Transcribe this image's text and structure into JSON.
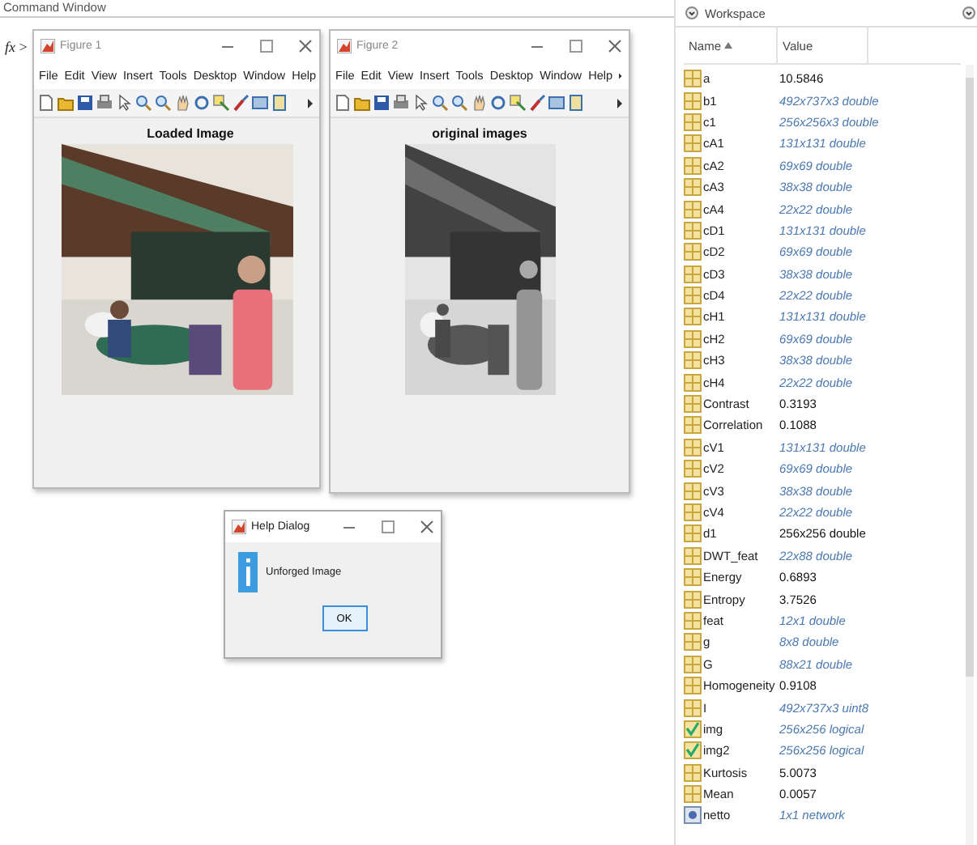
{
  "command_window": {
    "title": "Command Window",
    "prompt": "*fx* >"
  },
  "figures": [
    {
      "title": "Figure 1",
      "menu": [
        "File",
        "Edit",
        "View",
        "Insert",
        "Tools",
        "Desktop",
        "Window",
        "Help"
      ],
      "axes_title": "Loaded Image",
      "grayscale": false
    },
    {
      "title": "Figure 2",
      "menu": [
        "File",
        "Edit",
        "View",
        "Insert",
        "Tools",
        "Desktop",
        "Window",
        "Help"
      ],
      "axes_title": "original images",
      "grayscale": true
    }
  ],
  "dialog": {
    "title": "Help Dialog",
    "message": "Unforged Image",
    "button": "OK"
  },
  "workspace": {
    "title": "Workspace",
    "columns": [
      "Name",
      "Value"
    ],
    "variables": [
      {
        "name": "a",
        "value": "10.5846",
        "kind": "numeric",
        "summary": false
      },
      {
        "name": "b1",
        "value": "492x737x3 double",
        "kind": "numeric",
        "summary": true
      },
      {
        "name": "c1",
        "value": "256x256x3 double",
        "kind": "numeric",
        "summary": true
      },
      {
        "name": "cA1",
        "value": "131x131 double",
        "kind": "numeric",
        "summary": true
      },
      {
        "name": "cA2",
        "value": "69x69 double",
        "kind": "numeric",
        "summary": true
      },
      {
        "name": "cA3",
        "value": "38x38 double",
        "kind": "numeric",
        "summary": true
      },
      {
        "name": "cA4",
        "value": "22x22 double",
        "kind": "numeric",
        "summary": true
      },
      {
        "name": "cD1",
        "value": "131x131 double",
        "kind": "numeric",
        "summary": true
      },
      {
        "name": "cD2",
        "value": "69x69 double",
        "kind": "numeric",
        "summary": true
      },
      {
        "name": "cD3",
        "value": "38x38 double",
        "kind": "numeric",
        "summary": true
      },
      {
        "name": "cD4",
        "value": "22x22 double",
        "kind": "numeric",
        "summary": true
      },
      {
        "name": "cH1",
        "value": "131x131 double",
        "kind": "numeric",
        "summary": true
      },
      {
        "name": "cH2",
        "value": "69x69 double",
        "kind": "numeric",
        "summary": true
      },
      {
        "name": "cH3",
        "value": "38x38 double",
        "kind": "numeric",
        "summary": true
      },
      {
        "name": "cH4",
        "value": "22x22 double",
        "kind": "numeric",
        "summary": true
      },
      {
        "name": "Contrast",
        "value": "0.3193",
        "kind": "numeric",
        "summary": false
      },
      {
        "name": "Correlation",
        "value": "0.1088",
        "kind": "numeric",
        "summary": false
      },
      {
        "name": "cV1",
        "value": "131x131 double",
        "kind": "numeric",
        "summary": true
      },
      {
        "name": "cV2",
        "value": "69x69 double",
        "kind": "numeric",
        "summary": true
      },
      {
        "name": "cV3",
        "value": "38x38 double",
        "kind": "numeric",
        "summary": true
      },
      {
        "name": "cV4",
        "value": "22x22 double",
        "kind": "numeric",
        "summary": true
      },
      {
        "name": "d1",
        "value": "256x256 double",
        "kind": "numeric",
        "summary": false
      },
      {
        "name": "DWT_feat",
        "value": "22x88 double",
        "kind": "numeric",
        "summary": true
      },
      {
        "name": "Energy",
        "value": "0.6893",
        "kind": "numeric",
        "summary": false
      },
      {
        "name": "Entropy",
        "value": "3.7526",
        "kind": "numeric",
        "summary": false
      },
      {
        "name": "feat",
        "value": "12x1 double",
        "kind": "numeric",
        "summary": true
      },
      {
        "name": "g",
        "value": "8x8 double",
        "kind": "numeric",
        "summary": true
      },
      {
        "name": "G",
        "value": "88x21 double",
        "kind": "numeric",
        "summary": true
      },
      {
        "name": "Homogeneity",
        "value": "0.9108",
        "kind": "numeric",
        "summary": false
      },
      {
        "name": "I",
        "value": "492x737x3 uint8",
        "kind": "numeric",
        "summary": true
      },
      {
        "name": "img",
        "value": "256x256 logical",
        "kind": "logical",
        "summary": true
      },
      {
        "name": "img2",
        "value": "256x256 logical",
        "kind": "logical",
        "summary": true
      },
      {
        "name": "Kurtosis",
        "value": "5.0073",
        "kind": "numeric",
        "summary": false
      },
      {
        "name": "Mean",
        "value": "0.0057",
        "kind": "numeric",
        "summary": false
      },
      {
        "name": "netto",
        "value": "1x1 network",
        "kind": "object",
        "summary": true
      }
    ]
  }
}
